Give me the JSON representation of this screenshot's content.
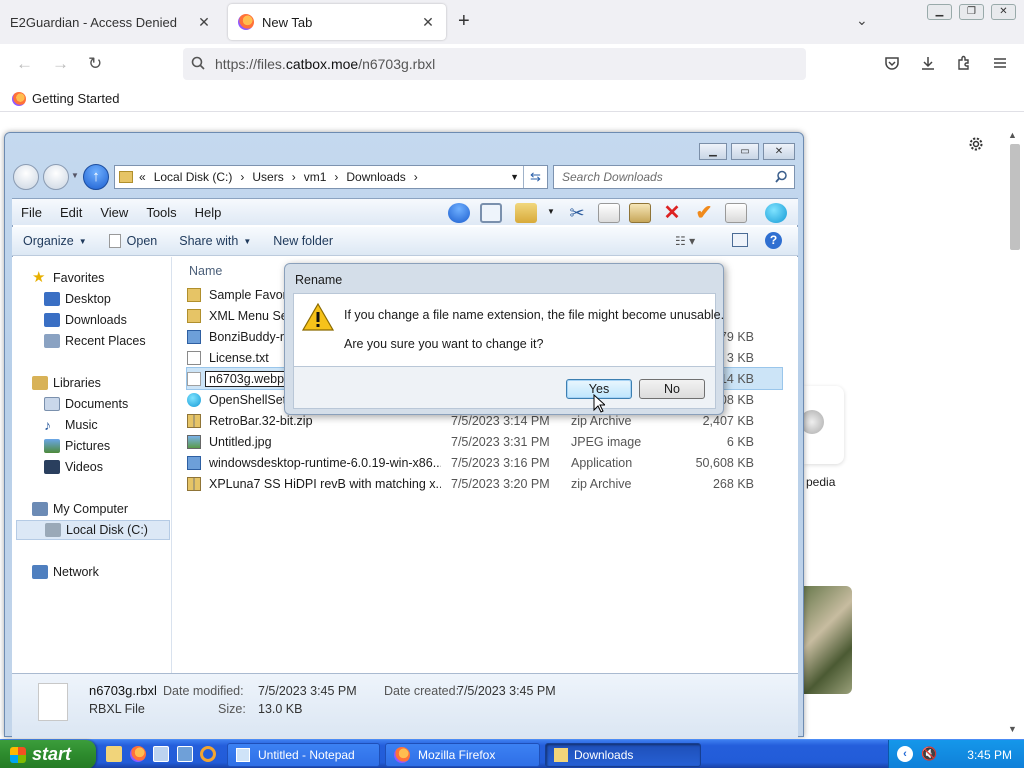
{
  "browser": {
    "tabs": [
      {
        "label": "E2Guardian - Access Denied"
      },
      {
        "label": "New Tab"
      }
    ],
    "url_prefix": "https://files.",
    "url_host": "catbox.moe",
    "url_path": "/n6703g.rbxl",
    "bookmark": "Getting Started",
    "bg_label_right": "pedia"
  },
  "explorer": {
    "breadcrumb": [
      "«",
      "Local Disk (C:)",
      "Users",
      "vm1",
      "Downloads"
    ],
    "search_placeholder": "Search Downloads",
    "menu": [
      "File",
      "Edit",
      "View",
      "Tools",
      "Help"
    ],
    "commands": {
      "organize": "Organize",
      "open": "Open",
      "share": "Share with",
      "new_folder": "New folder"
    },
    "column_name": "Name",
    "nav": {
      "favorites": "Favorites",
      "desktop": "Desktop",
      "downloads": "Downloads",
      "recent": "Recent Places",
      "libraries": "Libraries",
      "documents": "Documents",
      "music": "Music",
      "pictures": "Pictures",
      "videos": "Videos",
      "computer": "My Computer",
      "local_disk": "Local Disk (C:)",
      "network": "Network"
    },
    "files": [
      {
        "name": "Sample Favori",
        "date": "",
        "type": "",
        "size": "",
        "icon": "folder"
      },
      {
        "name": "XML Menu Se",
        "date": "",
        "type": "",
        "size": "",
        "icon": "folder"
      },
      {
        "name": "BonziBuddy-r",
        "date": "",
        "type": "",
        "size": "479 KB",
        "icon": "app"
      },
      {
        "name": "License.txt",
        "date": "",
        "type": "",
        "size": "3 KB",
        "icon": "text"
      },
      {
        "name": "n6703g.webp",
        "date": "",
        "type": "",
        "size": "14 KB",
        "icon": "blank"
      },
      {
        "name": "OpenShellSetu",
        "date": "",
        "type": "",
        "size": "208 KB",
        "icon": "shell"
      },
      {
        "name": "RetroBar.32-bit.zip",
        "date": "7/5/2023 3:14 PM",
        "type": "zip Archive",
        "size": "2,407 KB",
        "icon": "zip"
      },
      {
        "name": "Untitled.jpg",
        "date": "7/5/2023 3:31 PM",
        "type": "JPEG image",
        "size": "6 KB",
        "icon": "image"
      },
      {
        "name": "windowsdesktop-runtime-6.0.19-win-x86...",
        "date": "7/5/2023 3:16 PM",
        "type": "Application",
        "size": "50,608 KB",
        "icon": "app"
      },
      {
        "name": "XPLuna7 SS HiDPI revB with matching x...",
        "date": "7/5/2023 3:20 PM",
        "type": "zip Archive",
        "size": "268 KB",
        "icon": "zip"
      }
    ],
    "details": {
      "filename": "n6703g.rbxl",
      "modified_label": "Date modified:",
      "modified": "7/5/2023 3:45 PM",
      "created_label": "Date created:",
      "created": "7/5/2023 3:45 PM",
      "type": "RBXL File",
      "size_label": "Size:",
      "size": "13.0 KB"
    }
  },
  "dialog": {
    "title": "Rename",
    "line1": "If you change a file name extension, the file might become unusable.",
    "line2": "Are you sure you want to change it?",
    "yes": "Yes",
    "no": "No"
  },
  "taskbar": {
    "start": "start",
    "tasks": [
      {
        "label": "Untitled - Notepad"
      },
      {
        "label": "Mozilla Firefox"
      },
      {
        "label": "Downloads"
      }
    ],
    "clock": "3:45 PM"
  },
  "colors": {
    "taskbar_blue": "#245edb",
    "start_green": "#2d8b2d",
    "firefox_orange": "#ff7139"
  }
}
